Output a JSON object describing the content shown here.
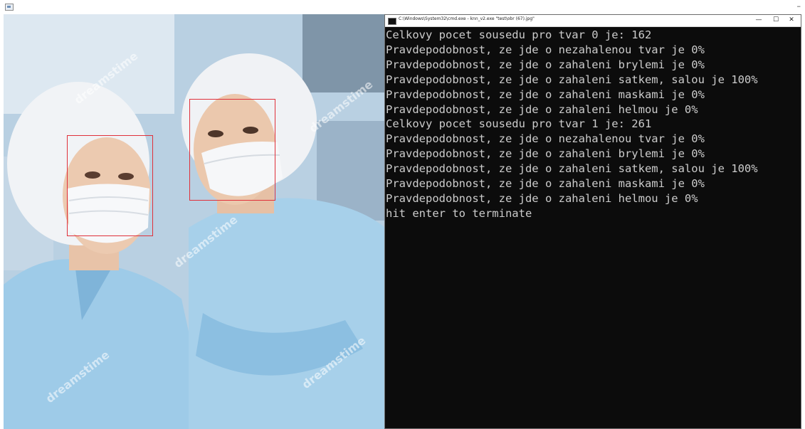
{
  "window": {
    "minimize_glyph": "–"
  },
  "console": {
    "title": "C:\\Windows\\System32\\cmd.exe - knn_v2.exe  \"test\\obr (67).jpg\"",
    "buttons": {
      "minimize": "—",
      "maximize": "☐",
      "close": "✕"
    },
    "lines": [
      "Celkovy pocet sousedu pro tvar 0 je: 162",
      "Pravdepodobnost, ze jde o nezahalenou tvar je 0%",
      "Pravdepodobnost, ze jde o zahaleni brylemi je 0%",
      "Pravdepodobnost, ze jde o zahaleni satkem, salou je 100%",
      "Pravdepodobnost, ze jde o zahaleni maskami je 0%",
      "Pravdepodobnost, ze jde o zahaleni helmou je 0%",
      "Celkovy pocet sousedu pro tvar 1 je: 261",
      "Pravdepodobnost, ze jde o nezahalenou tvar je 0%",
      "Pravdepodobnost, ze jde o zahaleni brylemi je 0%",
      "Pravdepodobnost, ze jde o zahaleni satkem, salou je 100%",
      "Pravdepodobnost, ze jde o zahaleni maskami je 0%",
      "Pravdepodobnost, ze jde o zahaleni helmou je 0%",
      "hit enter to terminate"
    ]
  },
  "photo": {
    "watermark_text": "dreamstime",
    "box_color": "#e0303a"
  }
}
